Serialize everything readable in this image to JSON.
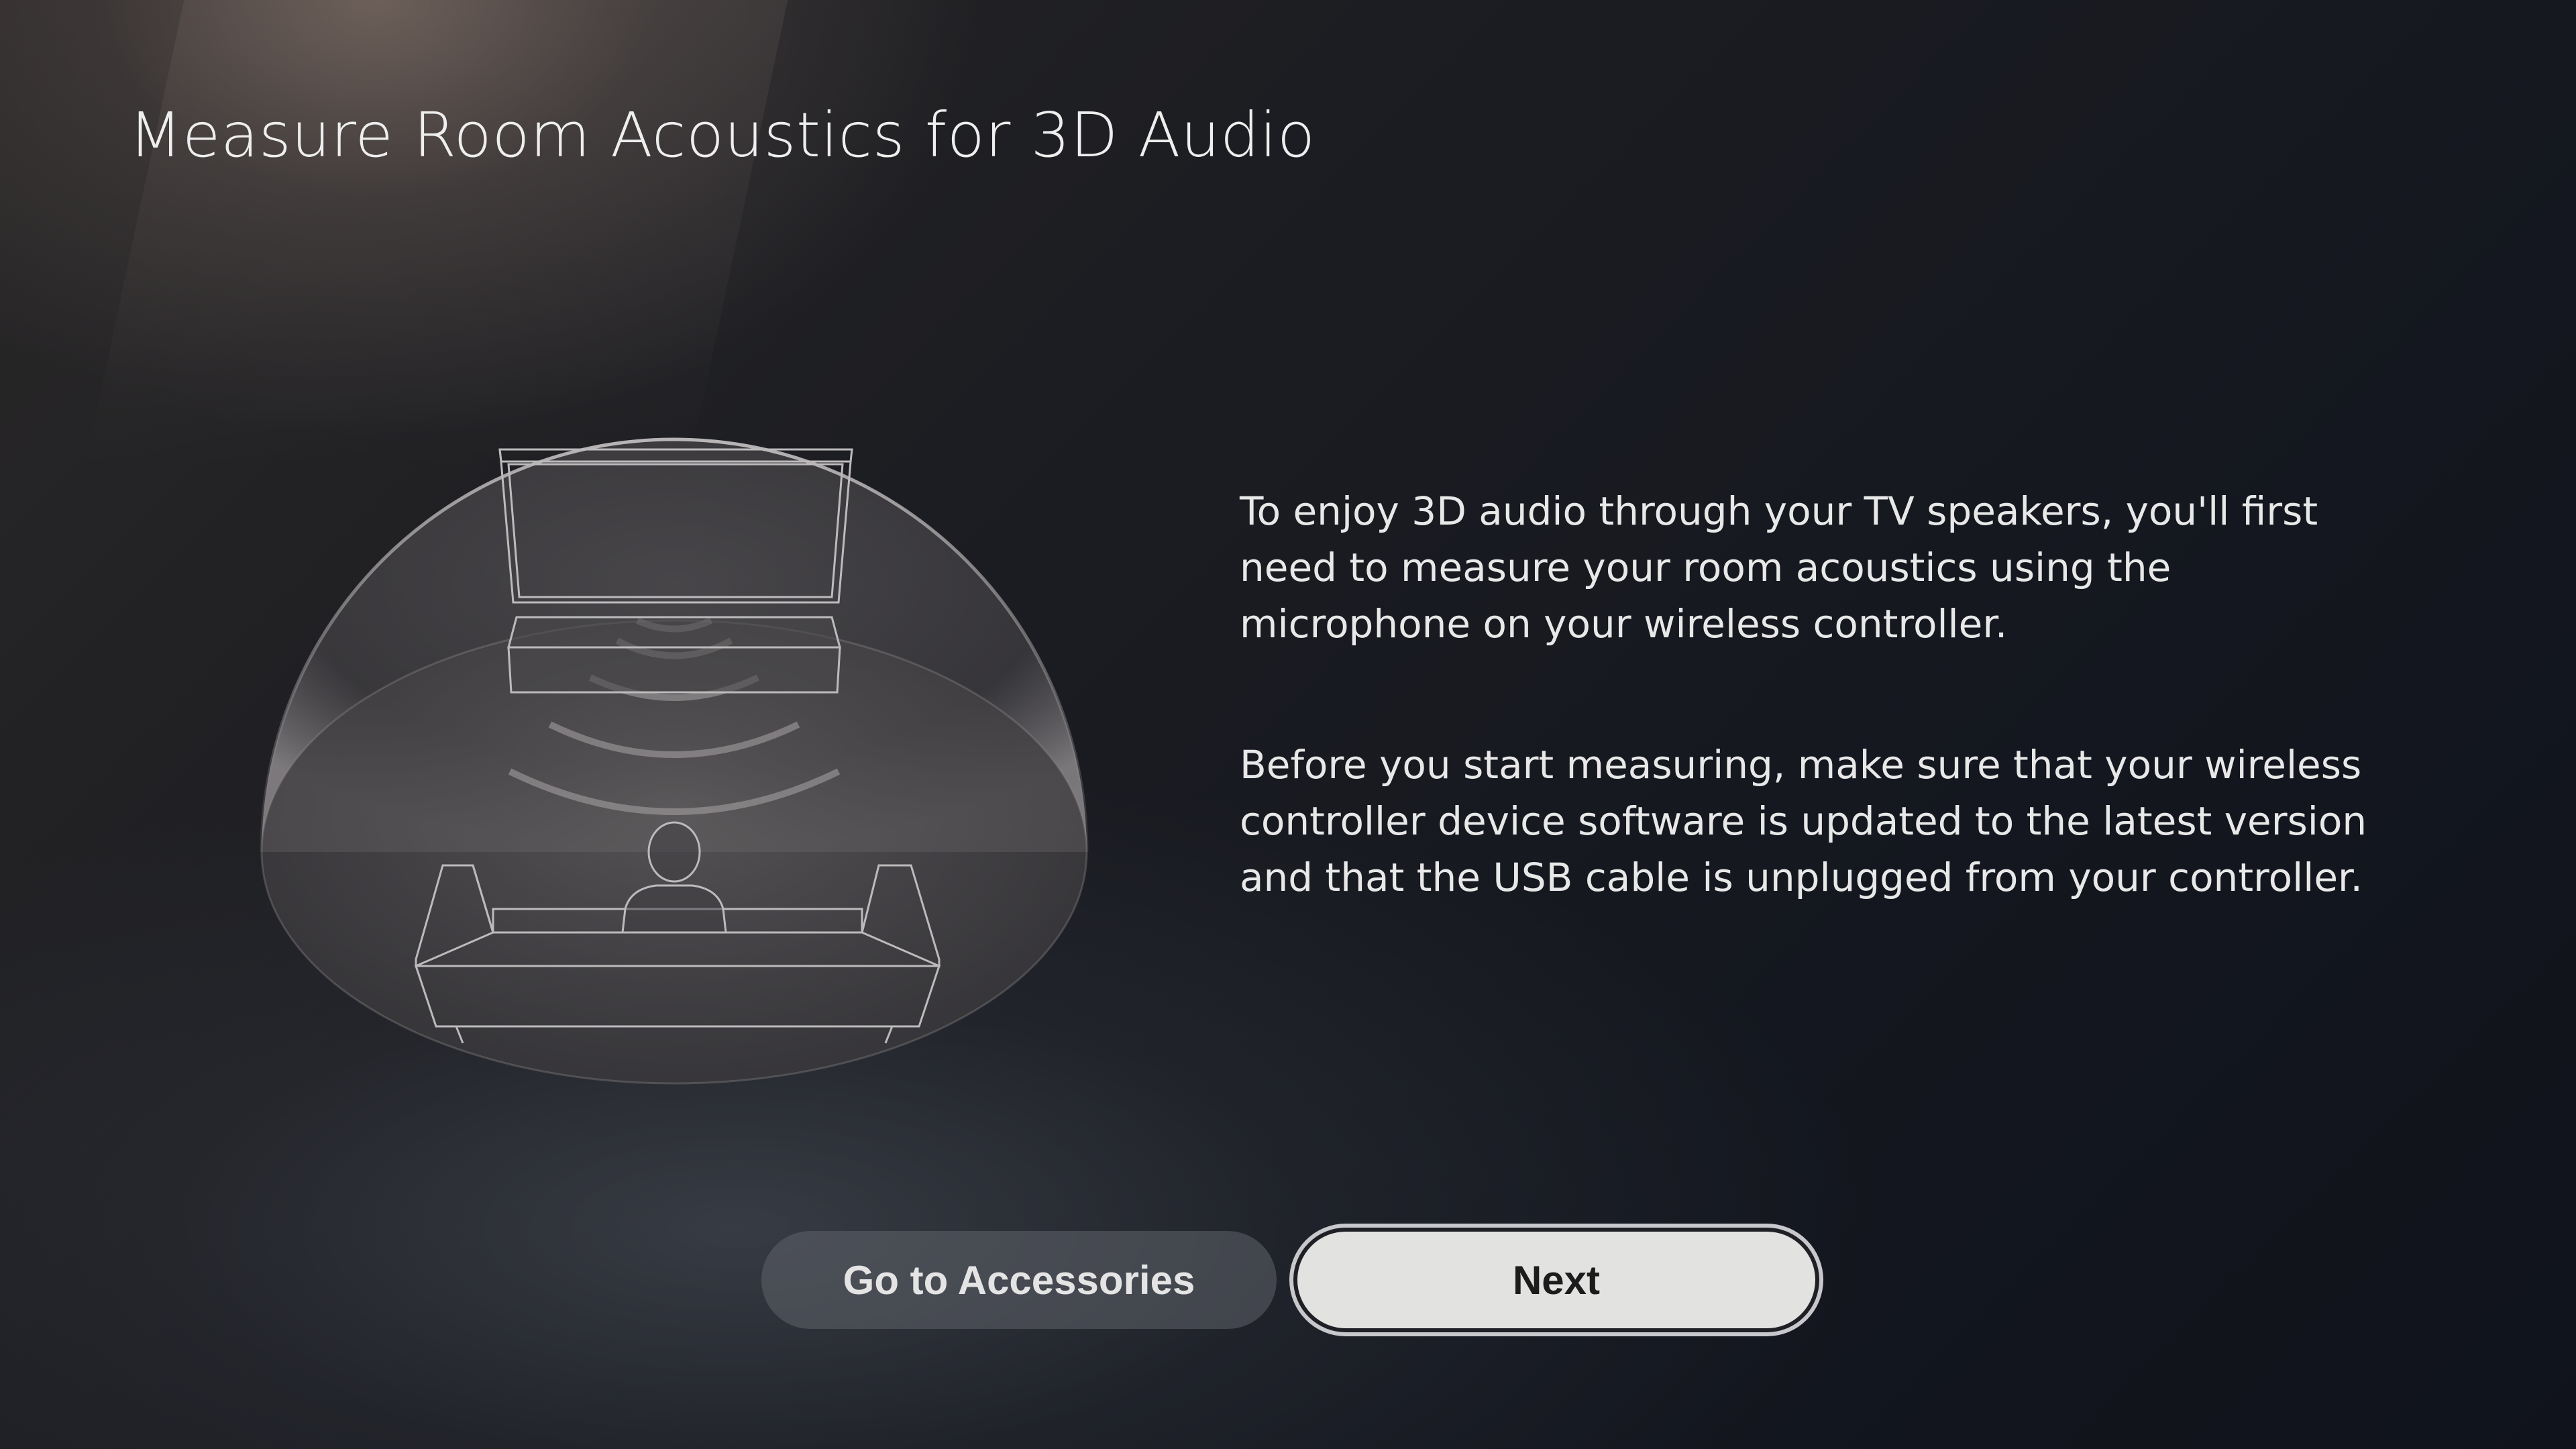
{
  "page": {
    "title": "Measure Room Acoustics for 3D Audio"
  },
  "content": {
    "paragraphs": [
      "To enjoy 3D audio through your TV speakers, you'll first need to measure your room acoustics using the microphone on your wireless controller.",
      "Before you start measuring, make sure that your wireless controller device software is updated to the latest version and that the USB cable is unplugged from your controller."
    ]
  },
  "buttons": {
    "accessories_label": "Go to Accessories",
    "next_label": "Next"
  },
  "illustration": {
    "subject": "tv-soundbar-sofa-listener-dome",
    "accent_color": "#8e8e90"
  }
}
